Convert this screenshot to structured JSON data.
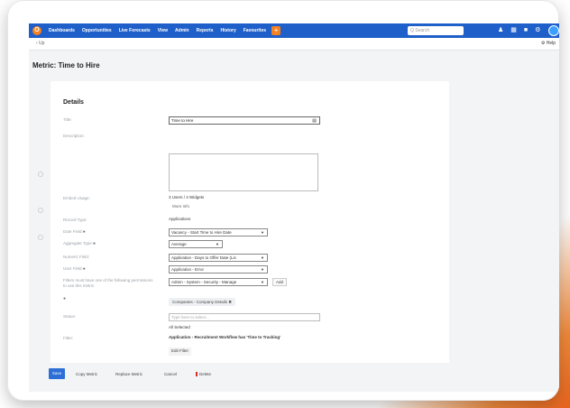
{
  "topbar": {
    "logo": "O",
    "nav": [
      "Dashboards",
      "Opportunities",
      "Live Forecasts",
      "View",
      "Admin",
      "Reports",
      "History",
      "Favourites"
    ],
    "plus": "+",
    "search_placeholder": "Q Search"
  },
  "subbar": {
    "breadcrumb": "‹ Up",
    "help": "⚙ Help"
  },
  "page_title": "Metric: Time to Hire",
  "details": {
    "section_title": "Details",
    "title_label": "Title:",
    "title_value": "Time to Hire",
    "description_label": "Description:",
    "embed_label": "Embed Usage:",
    "embed_value": "3 Users / 4 Widgets",
    "more_info": "More Info",
    "record_type_label": "Record Type:",
    "record_type_value": "Applications",
    "date_field_label": "Date Field:",
    "date_field_value": "Vacancy - Start Time to Hire Date",
    "aggregate_label": "Aggregate Type:",
    "aggregate_value": "Average",
    "numeric_label": "Numeric Field:",
    "numeric_value": "Application - Days to Offer Date (Lis",
    "user_field_label": "User Field:",
    "user_field_value": "Application - Error",
    "filters_label": "Filters must have one of the following permissions to use this metric:",
    "permission_value": "Admin - System - Security - Manage",
    "add_button": "Add",
    "chip": "Companies - Company Details ✖",
    "status_label": "Status:",
    "status_placeholder": "Type here to select...",
    "all_selected": "All Selected",
    "filter_label": "Filter:",
    "filter_value": "Application - Recruitment Workflow has 'Time to Tracking'",
    "edit_filter": "Edit Filter"
  },
  "footer": {
    "save": "Save",
    "copy": "Copy Metric",
    "replace": "Replace Metric",
    "cancel": "Cancel",
    "delete": "Delete"
  },
  "colors": {
    "nav": "#1f5fc9",
    "accent": "#f58220",
    "save": "#2d6fd6"
  }
}
